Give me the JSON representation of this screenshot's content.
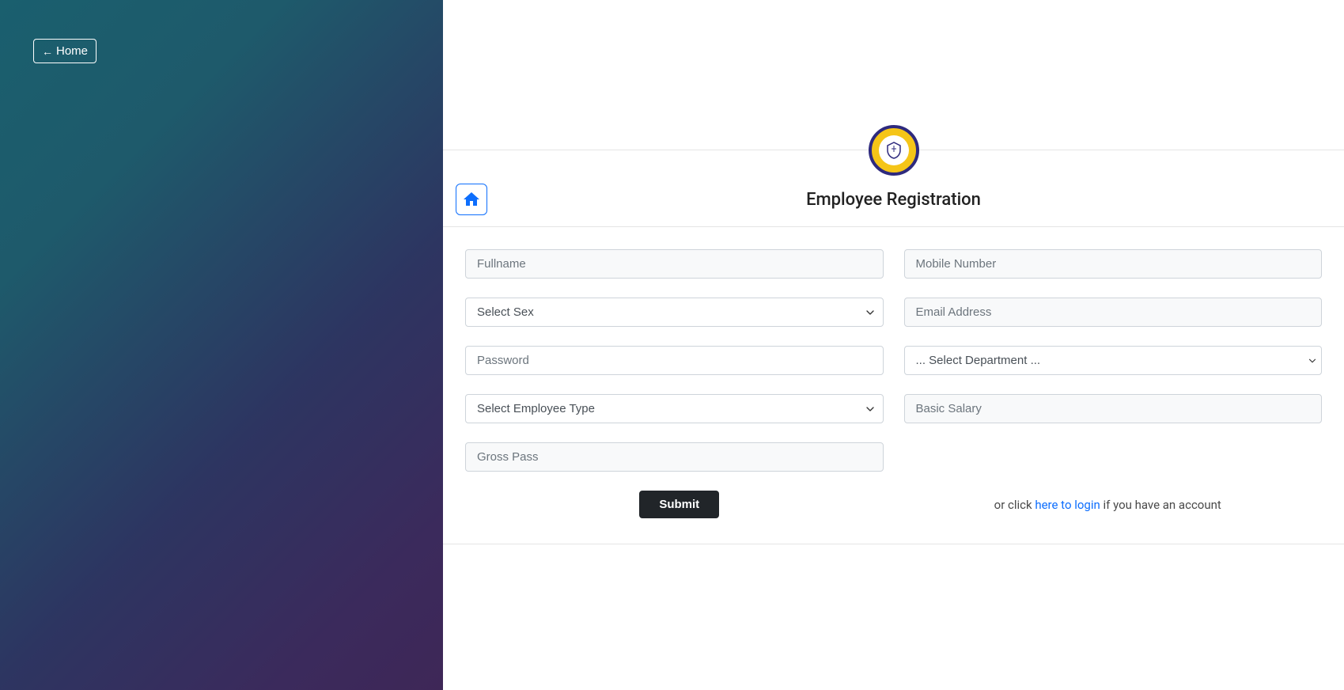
{
  "sidebar": {
    "home_button_label": "Home"
  },
  "header": {
    "page_title": "Employee Registration"
  },
  "form": {
    "fullname_placeholder": "Fullname",
    "mobile_placeholder": "Mobile Number",
    "sex_default": "Select Sex",
    "email_placeholder": "Email Address",
    "password_placeholder": "Password",
    "department_default": "... Select Department ...",
    "employee_type_default": "Select Employee Type",
    "basic_salary_placeholder": "Basic Salary",
    "gross_pass_placeholder": "Gross Pass",
    "submit_label": "Submit"
  },
  "footer": {
    "login_prefix": "or click ",
    "login_link": "here to login",
    "login_suffix": " if you have an account"
  }
}
